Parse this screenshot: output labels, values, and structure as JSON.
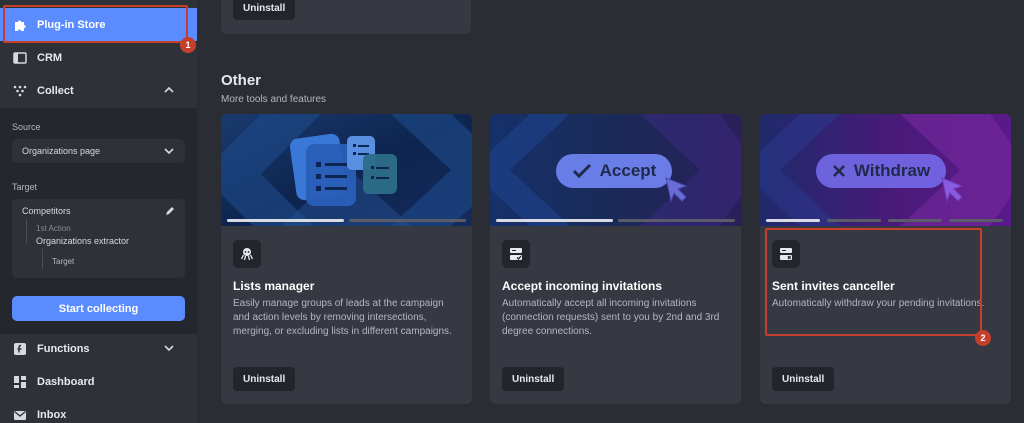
{
  "sidebar": {
    "plugin_store": "Plug-in Store",
    "crm": "CRM",
    "collect": "Collect",
    "source_label": "Source",
    "source_value": "Organizations page",
    "target_label": "Target",
    "target_name": "Competitors",
    "first_action": "1st Action",
    "extractor": "Organizations extractor",
    "target_leaf": "Target",
    "start_button": "Start collecting",
    "functions": "Functions",
    "dashboard": "Dashboard",
    "inbox": "Inbox"
  },
  "annotations": {
    "badge1": "1",
    "badge2": "2"
  },
  "main": {
    "prev_uninstall": "Uninstall",
    "section_title": "Other",
    "section_subtitle": "More tools and features",
    "cards": [
      {
        "title": "Lists manager",
        "description": "Easily manage groups of leads at the campaign and action levels by removing intersections, merging, or excluding lists in different campaigns.",
        "button": "Uninstall"
      },
      {
        "title": "Accept incoming invitations",
        "description": "Automatically accept all incoming invitations (connection requests) sent to you by 2nd and 3rd degree connections.",
        "button": "Uninstall",
        "banner_label": "Accept"
      },
      {
        "title": "Sent invites canceller",
        "description": "Automatically withdraw your pending invitations.",
        "button": "Uninstall",
        "banner_label": "Withdraw"
      }
    ]
  },
  "colors": {
    "accent": "#5b8cff",
    "highlight": "#c5402b"
  }
}
